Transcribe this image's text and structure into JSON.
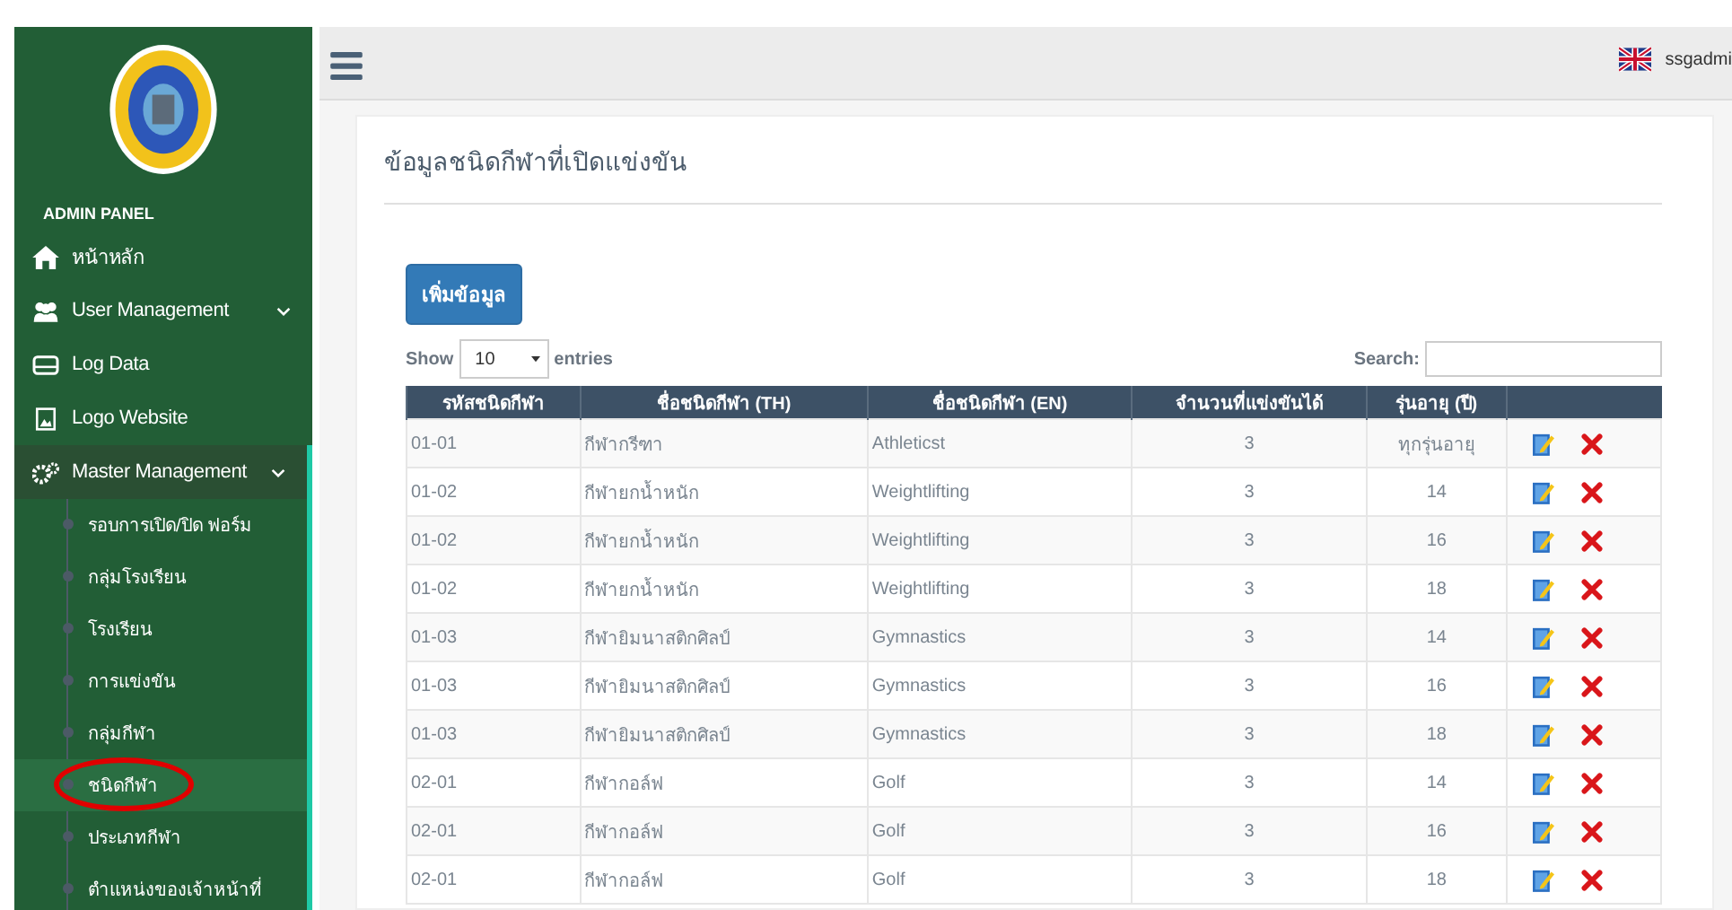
{
  "sidebar": {
    "title": "ADMIN PANEL",
    "items": [
      {
        "kind": "home",
        "label": "หน้าหลัก",
        "selected": false
      },
      {
        "kind": "users",
        "label": "User Management",
        "selected": false
      },
      {
        "kind": "log",
        "label": "Log Data",
        "selected": false
      },
      {
        "kind": "image",
        "label": "Logo Website",
        "selected": false
      },
      {
        "kind": "gears",
        "label": "Master Management",
        "selected": true,
        "expanded": true,
        "children": [
          {
            "label": "รอบการเปิด/ปิด ฟอร์ม",
            "selected": false,
            "circled": false
          },
          {
            "label": "กลุ่มโรงเรียน",
            "selected": false,
            "circled": false
          },
          {
            "label": "โรงเรียน",
            "selected": false,
            "circled": false
          },
          {
            "label": "การแข่งขัน",
            "selected": false,
            "circled": false
          },
          {
            "label": "กลุ่มกีฬา",
            "selected": false,
            "circled": false
          },
          {
            "label": "ชนิดกีฬา",
            "selected": true,
            "circled": true
          },
          {
            "label": "ประเภทกีฬา",
            "selected": false,
            "circled": false
          },
          {
            "label": "ตำแหน่งของเจ้าหน้าที่",
            "selected": false,
            "circled": false
          }
        ]
      }
    ]
  },
  "topbar": {
    "user": "ssgadmi"
  },
  "page": {
    "title": "ข้อมูลชนิดกีฬาที่เปิดแข่งขัน",
    "add_button": "เพิ่มข้อมูล",
    "show_label": "Show",
    "entries_value": "10",
    "entries_label": "entries",
    "search_label": "Search:"
  },
  "table": {
    "columns": [
      "รหัสชนิดกีฬา",
      "ชื่อชนิดกีฬา (TH)",
      "ชื่อชนิดกีฬา (EN)",
      "จำนวนที่แข่งขันได้",
      "รุ่นอายุ (ปี)"
    ],
    "rows": [
      [
        "01-01",
        "กีฬากรีฑา",
        "Athleticst",
        "3",
        "ทุกรุ่นอายุ"
      ],
      [
        "01-02",
        "กีฬายกน้ำหนัก",
        "Weightlifting",
        "3",
        "14"
      ],
      [
        "01-02",
        "กีฬายกน้ำหนัก",
        "Weightlifting",
        "3",
        "16"
      ],
      [
        "01-02",
        "กีฬายกน้ำหนัก",
        "Weightlifting",
        "3",
        "18"
      ],
      [
        "01-03",
        "กีฬายิมนาสติกศิลป์",
        "Gymnastics",
        "3",
        "14"
      ],
      [
        "01-03",
        "กีฬายิมนาสติกศิลป์",
        "Gymnastics",
        "3",
        "16"
      ],
      [
        "01-03",
        "กีฬายิมนาสติกศิลป์",
        "Gymnastics",
        "3",
        "18"
      ],
      [
        "02-01",
        "กีฬากอล์ฟ",
        "Golf",
        "3",
        "14"
      ],
      [
        "02-01",
        "กีฬากอล์ฟ",
        "Golf",
        "3",
        "16"
      ],
      [
        "02-01",
        "กีฬากอล์ฟ",
        "Golf",
        "3",
        "18"
      ]
    ]
  }
}
